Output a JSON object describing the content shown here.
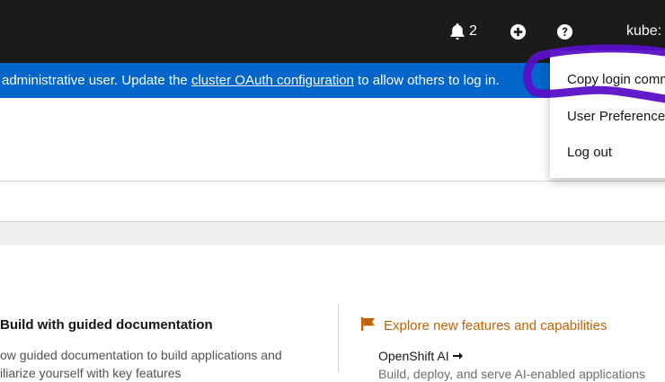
{
  "masthead": {
    "notifications_count": "2",
    "user_label": "kube:",
    "icons": [
      "bell-icon",
      "plus-circle-icon",
      "question-circle-icon"
    ],
    "background": "#1b1b1b"
  },
  "banner": {
    "text_before": "administrative user. Update the ",
    "link_text": "cluster OAuth configuration",
    "text_after": " to allow others to log in.",
    "background": "#0066cc"
  },
  "user_menu": {
    "items": [
      {
        "label": "Copy login comm"
      },
      {
        "label": "User Preference"
      },
      {
        "label": "Log out"
      }
    ]
  },
  "getting_started": {
    "left_card": {
      "title": "Build with guided documentation",
      "desc_line1": "ow guided documentation to build applications and",
      "desc_line2": "iliarize yourself with key features"
    },
    "right_card": {
      "title": "Explore new features and capabilities",
      "link": "OpenShift AI",
      "desc": "Build, deploy, and serve AI-enabled applications",
      "accent": "#c46100"
    }
  },
  "annotation_color": "#5a0fc8"
}
